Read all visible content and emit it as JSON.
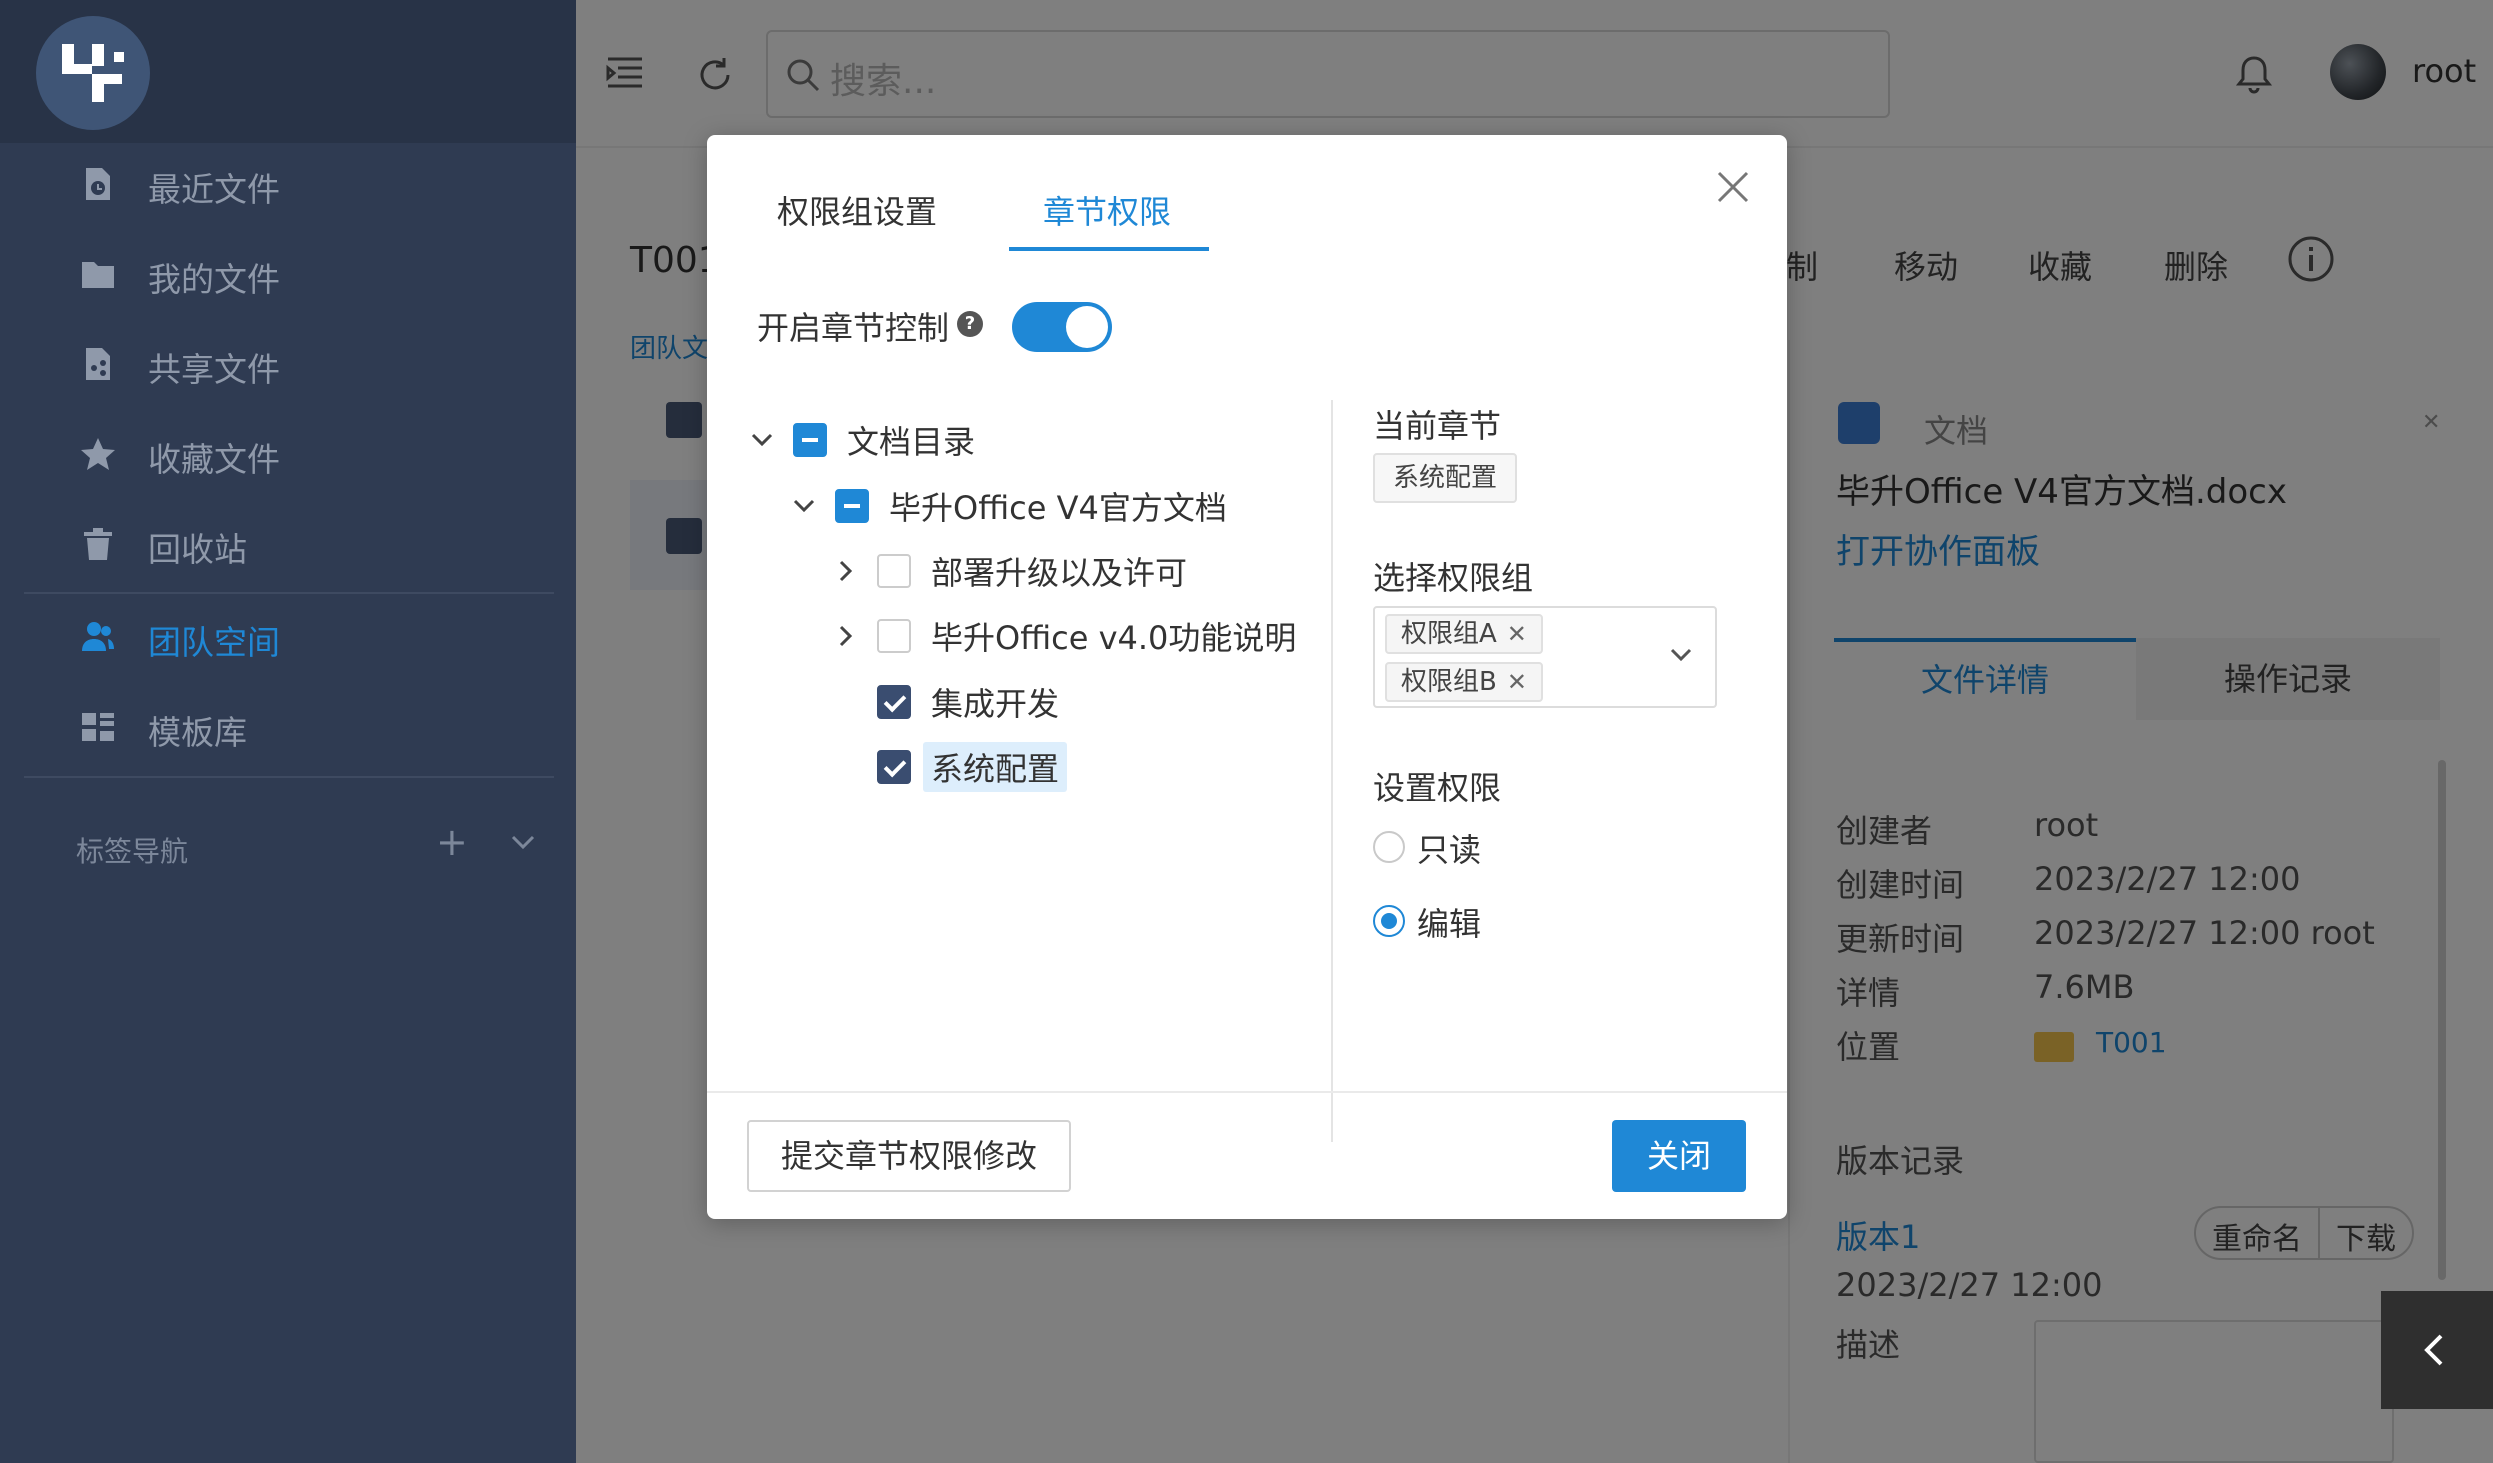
{
  "sidebar": {
    "items": [
      {
        "label": "最近文件",
        "icon": "recent-file-icon"
      },
      {
        "label": "我的文件",
        "icon": "folder-icon"
      },
      {
        "label": "共享文件",
        "icon": "share-file-icon"
      },
      {
        "label": "收藏文件",
        "icon": "star-icon"
      },
      {
        "label": "回收站",
        "icon": "trash-icon"
      },
      {
        "label": "团队空间",
        "icon": "team-icon",
        "active": true
      },
      {
        "label": "模板库",
        "icon": "template-icon"
      }
    ],
    "tag_nav_label": "标签导航"
  },
  "header": {
    "search_placeholder": "搜索...",
    "user_name": "root"
  },
  "main": {
    "breadcrumb": "T001",
    "sub_breadcrumb": "团队文",
    "actions": [
      "制",
      "移动",
      "收藏",
      "删除"
    ]
  },
  "detail": {
    "type_label": "文档",
    "filename": "毕升Office V4官方文档.docx",
    "open_board": "打开协作面板",
    "tabs": [
      "文件详情",
      "操作记录"
    ],
    "rows": [
      {
        "key": "创建者",
        "value": "root"
      },
      {
        "key": "创建时间",
        "value": "2023/2/27 12:00"
      },
      {
        "key": "更新时间",
        "value": "2023/2/27 12:00 root"
      },
      {
        "key": "详情",
        "value": "7.6MB"
      },
      {
        "key": "位置",
        "value": "T001"
      }
    ],
    "version_title": "版本记录",
    "version_name": "版本1",
    "version_rename": "重命名",
    "version_download": "下载",
    "version_date": "2023/2/27 12:00",
    "desc_label": "描述"
  },
  "dialog": {
    "tabs": [
      "权限组设置",
      "章节权限"
    ],
    "active_tab": 1,
    "control_label": "开启章节控制",
    "control_enabled": true,
    "tree": [
      {
        "label": "文档目录",
        "state": "indeterminate",
        "expanded": true,
        "level": 0
      },
      {
        "label": "毕升Office V4官方文档",
        "state": "indeterminate",
        "expanded": true,
        "level": 1
      },
      {
        "label": "部署升级以及许可",
        "state": "unchecked",
        "expanded": false,
        "level": 2
      },
      {
        "label": "毕升Office v4.0功能说明",
        "state": "unchecked",
        "expanded": false,
        "level": 2
      },
      {
        "label": "集成开发",
        "state": "checked",
        "level": 2
      },
      {
        "label": "系统配置",
        "state": "checked",
        "level": 2,
        "selected": true
      }
    ],
    "current_chapter_label": "当前章节",
    "current_chapter": "系统配置",
    "select_group_label": "选择权限组",
    "groups": [
      "权限组A",
      "权限组B"
    ],
    "set_permission_label": "设置权限",
    "permission_options": [
      "只读",
      "编辑"
    ],
    "permission_selected": "编辑",
    "submit_label": "提交章节权限修改",
    "close_label": "关闭"
  }
}
